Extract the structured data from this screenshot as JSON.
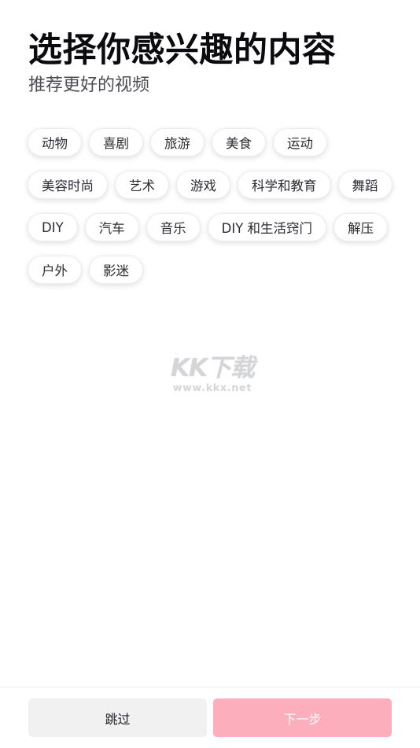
{
  "header": {
    "title": "选择你感兴趣的内容",
    "subtitle": "推荐更好的视频"
  },
  "tags": [
    "动物",
    "喜剧",
    "旅游",
    "美食",
    "运动",
    "美容时尚",
    "艺术",
    "游戏",
    "科学和教育",
    "舞蹈",
    "DIY",
    "汽车",
    "音乐",
    "DIY 和生活窍门",
    "解压",
    "户外",
    "影迷"
  ],
  "watermark": {
    "logo": "KK下载",
    "url": "www.kkx.net"
  },
  "footer": {
    "skip_label": "跳过",
    "next_label": "下一步"
  },
  "colors": {
    "next_button_bg": "#fcaebc",
    "skip_button_bg": "#f1f1f2"
  }
}
